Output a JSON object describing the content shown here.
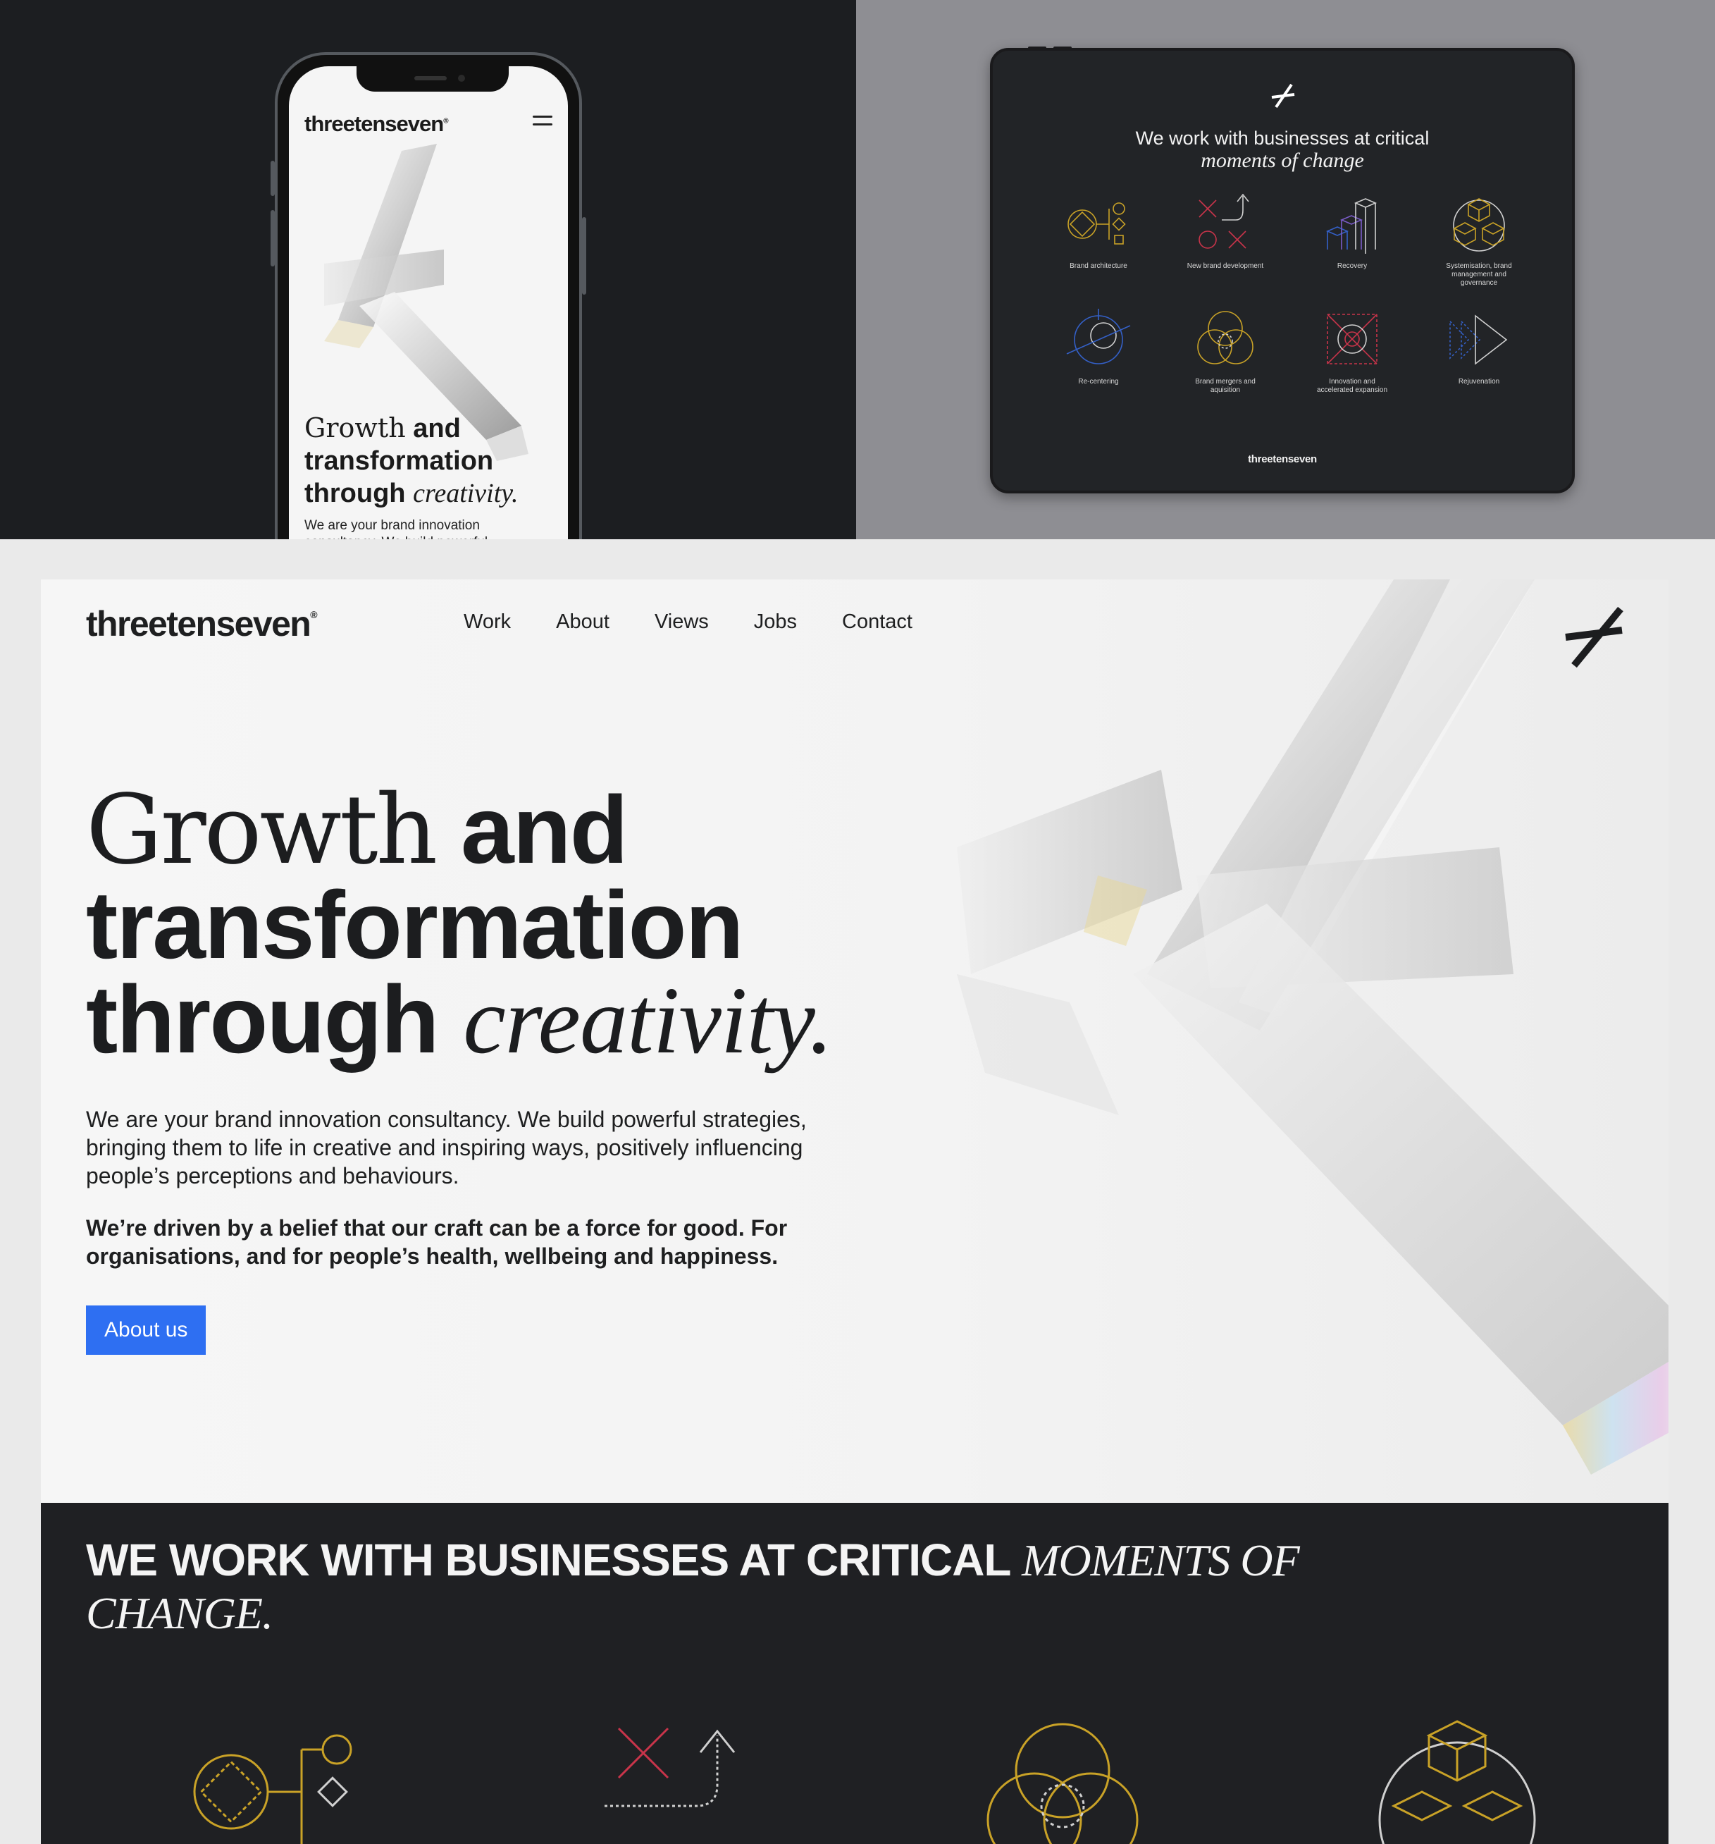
{
  "mobile": {
    "logo": "threetenseven",
    "logo_mark": "®",
    "headline": {
      "serif": "Growth",
      "bold_1": " and transformation through",
      "italic": "creativity."
    },
    "intro": "We are your brand innovation consultancy. We build powerful"
  },
  "tablet": {
    "title_plain": "We work with businesses at critical",
    "title_italic": "moments of change",
    "services": [
      {
        "label": "Brand architecture",
        "icon": "brand-architecture-icon"
      },
      {
        "label": "New brand development",
        "icon": "new-brand-development-icon"
      },
      {
        "label": "Recovery",
        "icon": "recovery-icon"
      },
      {
        "label": "Systemisation, brand management and governance",
        "icon": "systemisation-icon"
      },
      {
        "label": "Re-centering",
        "icon": "re-centering-icon"
      },
      {
        "label": "Brand mergers and aquisition",
        "icon": "brand-mergers-icon"
      },
      {
        "label": "Innovation and accelerated expansion",
        "icon": "innovation-icon"
      },
      {
        "label": "Rejuvenation",
        "icon": "rejuvenation-icon"
      }
    ],
    "footer_logo": "threetenseven"
  },
  "desktop": {
    "logo": "threetenseven",
    "logo_mark": "®",
    "nav": [
      "Work",
      "About",
      "Views",
      "Jobs",
      "Contact"
    ],
    "headline": {
      "line1_serif": "Growth",
      "line1_bold": " and",
      "line2": "transformation",
      "line3_bold": "through ",
      "line3_italic": "creativity."
    },
    "intro": "We are your brand innovation consultancy. We build powerful strategies, bringing them to life in creative and inspiring ways, positively influencing people’s perceptions and behaviours.",
    "belief": "We’re driven by a belief that our craft can be a force for good. For organisations, and for people’s health, wellbeing and happiness.",
    "cta_label": "About us",
    "section_title_plain": "WE WORK WITH BUSINESSES AT CRITICAL ",
    "section_title_italic": "MOMENTS OF CHANGE."
  },
  "colors": {
    "accent_blue": "#2e6ff2",
    "dark_bg": "#1f2023",
    "icon_gold": "#c9a227",
    "icon_red": "#c8344a",
    "icon_blue": "#3460c8"
  }
}
